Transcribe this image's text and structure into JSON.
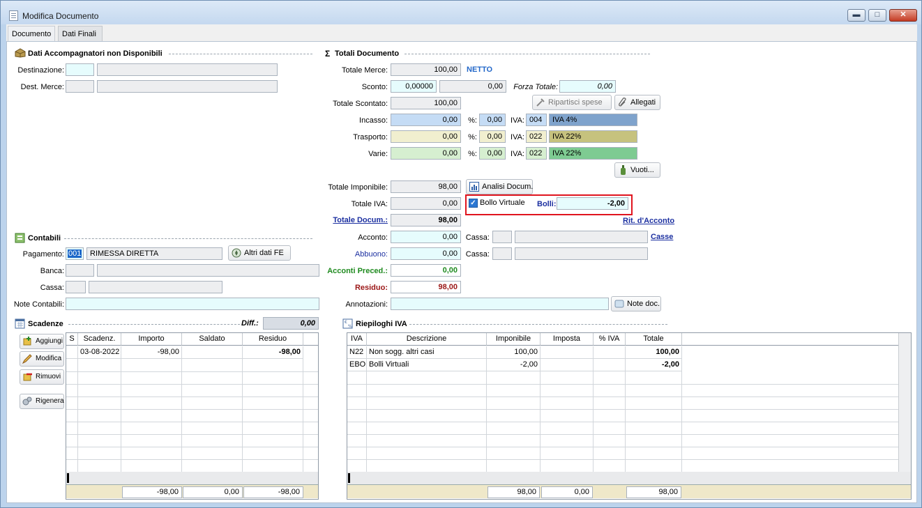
{
  "window": {
    "title": "Modifica Documento"
  },
  "tabs": [
    "Documento",
    "Dati Finali"
  ],
  "accompagnatori": {
    "title": "Dati Accompagnatori non Disponibili",
    "destinazione_label": "Destinazione:",
    "dest_merce_label": "Dest. Merce:"
  },
  "totali": {
    "title": "Totali Documento",
    "totale_merce_label": "Totale Merce:",
    "totale_merce": "100,00",
    "netto": "NETTO",
    "sconto_label": "Sconto:",
    "sconto_pct": "0,00000",
    "sconto_val": "0,00",
    "forza_totale_label": "Forza Totale:",
    "forza_totale": "0,00",
    "totale_scontato_label": "Totale Scontato:",
    "totale_scontato": "100,00",
    "ripartisci_label": "Ripartisci spese",
    "allegati_label": "Allegati",
    "pct_label": "%:",
    "iva_label": "IVA:",
    "incasso_label": "Incasso:",
    "incasso": "0,00",
    "incasso_pct": "0,00",
    "incasso_iva_code": "004",
    "incasso_iva_desc": "IVA  4%",
    "trasporto_label": "Trasporto:",
    "trasporto": "0,00",
    "trasporto_pct": "0,00",
    "trasporto_iva_code": "022",
    "trasporto_iva_desc": "IVA 22%",
    "varie_label": "Varie:",
    "varie": "0,00",
    "varie_pct": "0,00",
    "varie_iva_code": "022",
    "varie_iva_desc": "IVA 22%",
    "vuoti_label": "Vuoti...",
    "totale_imponibile_label": "Totale Imponibile:",
    "totale_imponibile": "98,00",
    "analisi_label": "Analisi Docum.",
    "totale_iva_label": "Totale IVA:",
    "totale_iva": "0,00",
    "bollo_virtuale_label": "Bollo Virtuale",
    "bolli_label": "Bolli:",
    "bolli": "-2,00",
    "totale_docum_label": "Totale Docum.:",
    "totale_docum": "98,00",
    "rit_acconto_label": "Rit. d'Acconto",
    "acconto_label": "Acconto:",
    "acconto": "0,00",
    "cassa_label": "Cassa:",
    "casse_link": "Casse",
    "abbuono_label": "Abbuono:",
    "abbuono": "0,00",
    "acconti_preced_label": "Acconti Preced.:",
    "acconti_preced": "0,00",
    "residuo_label": "Residuo:",
    "residuo": "98,00",
    "annotazioni_label": "Annotazioni:",
    "note_doc_label": "Note doc."
  },
  "contabili": {
    "title": "Contabili",
    "pagamento_label": "Pagamento:",
    "pagamento_code": "001",
    "pagamento_desc": "RIMESSA DIRETTA",
    "altri_dati_fe": "Altri dati FE",
    "banca_label": "Banca:",
    "cassa_label": "Cassa:",
    "note_contabili_label": "Note Contabili:"
  },
  "scadenze": {
    "title": "Scadenze",
    "diff_label": "Diff.:",
    "diff": "0,00",
    "buttons": [
      "Aggiungi",
      "Modifica",
      "Rimuovi",
      "Rigenera"
    ],
    "columns": [
      "S",
      "Scadenz.",
      "Importo",
      "Saldato",
      "Residuo"
    ],
    "rows": [
      [
        "",
        "03-08-2022",
        "-98,00",
        "",
        "-98,00"
      ]
    ],
    "footer": [
      "-98,00",
      "0,00",
      "-98,00"
    ]
  },
  "riepiloghi": {
    "title": "Riepiloghi IVA",
    "columns": [
      "IVA",
      "Descrizione",
      "Imponibile",
      "Imposta",
      "% IVA",
      "Totale"
    ],
    "rows": [
      [
        "N22",
        "Non sogg. altri casi",
        "100,00",
        "",
        "",
        "100,00"
      ],
      [
        "EBO",
        "Bolli Virtuali",
        "-2,00",
        "",
        "",
        "-2,00"
      ]
    ],
    "footer": [
      "98,00",
      "0,00",
      "98,00"
    ]
  },
  "colors": {
    "incasso": "#c5dcf5",
    "trasporto": "#f1efcf",
    "varie": "#d6efd0",
    "iva4": "#7fa3cc",
    "iva22_trasporto": "#c6c27e",
    "iva22_varie": "#7ecb92",
    "highlight_border": "#e0141e"
  }
}
